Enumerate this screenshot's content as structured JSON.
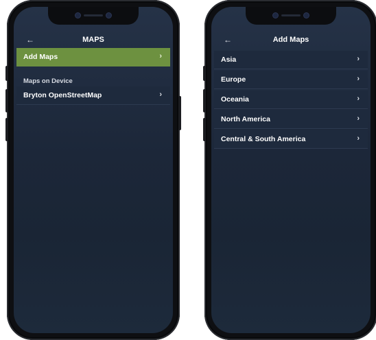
{
  "left_screen": {
    "header": {
      "back_icon": "←",
      "title": "MAPS"
    },
    "add_maps": {
      "label": "Add Maps",
      "chevron": "›"
    },
    "section_label": "Maps on Device",
    "device_maps": [
      {
        "label": "Bryton OpenStreetMap",
        "chevron": "›"
      }
    ]
  },
  "right_screen": {
    "header": {
      "back_icon": "←",
      "title": "Add Maps"
    },
    "regions": [
      {
        "label": "Asia",
        "chevron": "›"
      },
      {
        "label": "Europe",
        "chevron": "›"
      },
      {
        "label": "Oceania",
        "chevron": "›"
      },
      {
        "label": "North America",
        "chevron": "›"
      },
      {
        "label": "Central & South America",
        "chevron": "›"
      }
    ]
  },
  "colors": {
    "accent_green": "#6d9140",
    "screen_bg": "#1e2a3d",
    "text": "#ffffff"
  }
}
